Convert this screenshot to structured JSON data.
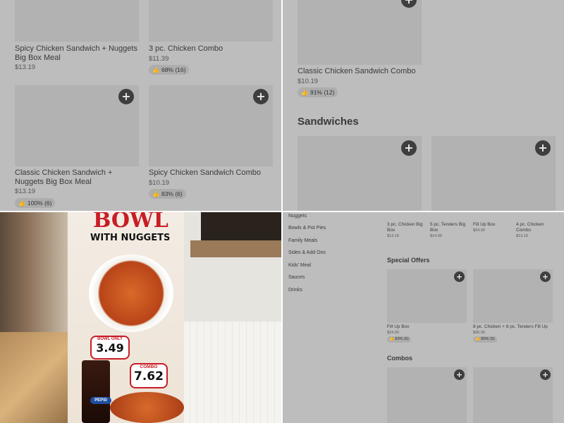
{
  "top_left": {
    "items": [
      {
        "name": "Spicy Chicken Sandwich + Nuggets Big Box Meal",
        "price": "$13.19",
        "rating": ""
      },
      {
        "name": "3 pc. Chicken Combo",
        "price": "$11.39",
        "rating": "68% (16)"
      },
      {
        "name": "Classic Chicken Sandwich + Nuggets Big Box Meal",
        "price": "$13.19",
        "rating": "100% (6)"
      },
      {
        "name": "Spicy Chicken Sandwich Combo",
        "price": "$10.19",
        "rating": "83% (6)"
      }
    ]
  },
  "top_right": {
    "item": {
      "name": "Classic Chicken Sandwich Combo",
      "price": "$10.19",
      "rating": "91% (12)"
    },
    "section_title": "Sandwiches"
  },
  "bottom_left": {
    "poster": {
      "headline": "BOWL",
      "subheadline": "WITH NUGGETS",
      "bowl_label": "BOWL ONLY",
      "bowl_price": "3.49",
      "combo_label": "COMBO",
      "combo_price": "7.62",
      "drink_brand": "PEPSI"
    }
  },
  "bottom_right": {
    "sidebar": [
      "Nuggets",
      "Bowls & Pot Pies",
      "Family Meals",
      "Sides & Add Ons",
      "Kids' Meal",
      "Sauces",
      "Drinks"
    ],
    "top_row": [
      {
        "name": "3 pc. Chicken Big Box",
        "price": "$13.19"
      },
      {
        "name": "5 pc. Tenders Big Box",
        "price": "$14.99"
      },
      {
        "name": "Fill Up Box",
        "price": "$24.00"
      },
      {
        "name": "4 pc. Chicken Combo",
        "price": "$13.19"
      }
    ],
    "special_offers_title": "Special Offers",
    "special_offers": [
      {
        "name": "Fill Up Box",
        "price": "$24.00",
        "rating": "83% (6)"
      },
      {
        "name": "8 pc. Chicken + 8 pc. Tenders Fill Up",
        "price": "$36.00",
        "rating": "80% (5)"
      }
    ],
    "combos_title": "Combos"
  },
  "colors": {
    "button": "#3e3e3e",
    "overlay_gray": "#bdbdbd",
    "placeholder": "#b2b2b2",
    "poster_red": "#c81d25"
  }
}
